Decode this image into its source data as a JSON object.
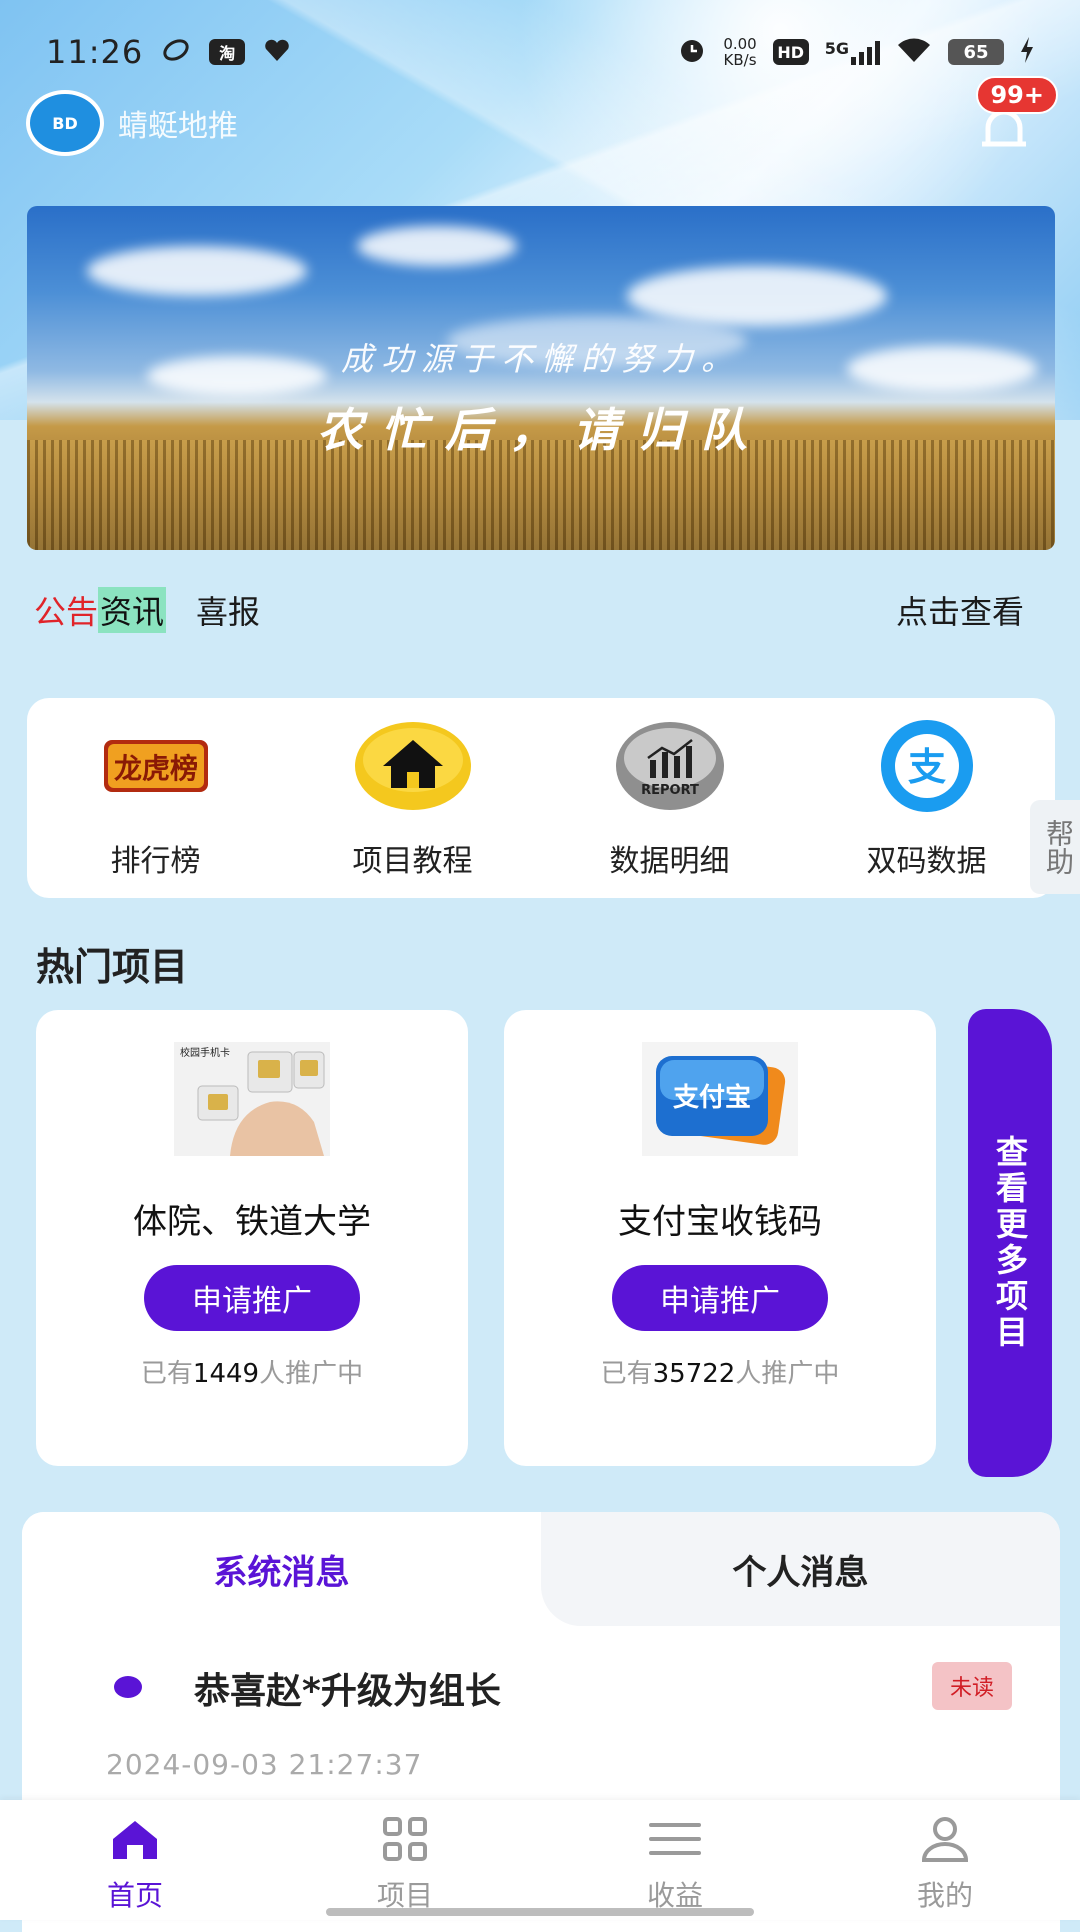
{
  "status_bar": {
    "time": "11:26",
    "left_icons": [
      "clouds-icon",
      "taobao-icon",
      "heart-icon"
    ],
    "taobao_label": "淘",
    "net_speed_value": "0.00",
    "net_speed_unit": "KB/s",
    "hd_label": "HD",
    "network": "5G",
    "battery": "65"
  },
  "app": {
    "name": "蜻蜓地推",
    "logo_text": "BD",
    "notification_badge": "99+"
  },
  "banner": {
    "line1": "成功源于不懈的努力。",
    "line2": "农忙后，请归队"
  },
  "notice": {
    "tag_red": "公告",
    "tag_green": "资讯",
    "title": "喜报",
    "more": "点击查看"
  },
  "quick_menu": [
    {
      "label": "排行榜",
      "icon": "ranking-badge-icon",
      "icon_text": "龙虎榜"
    },
    {
      "label": "项目教程",
      "icon": "home-icon"
    },
    {
      "label": "数据明细",
      "icon": "report-chart-icon",
      "icon_text": "REPORT"
    },
    {
      "label": "双码数据",
      "icon": "alipay-icon",
      "icon_text": "支"
    }
  ],
  "help_tab": "帮助",
  "hot_projects": {
    "title": "热门项目",
    "items": [
      {
        "name": "体院、铁道大学",
        "button": "申请推广",
        "count_prefix": "已有",
        "count": "1449",
        "count_suffix": "人推广中",
        "image_label": "校园手机卡"
      },
      {
        "name": "支付宝收钱码",
        "button": "申请推广",
        "count_prefix": "已有",
        "count": "35722",
        "count_suffix": "人推广中",
        "image_label": "支付宝"
      }
    ],
    "more": "查看更多项目"
  },
  "messages": {
    "tabs": [
      "系统消息",
      "个人消息"
    ],
    "active_tab": 0,
    "items": [
      {
        "title": "恭喜赵*升级为组长",
        "status": "未读",
        "time": "2024-09-03 21:27:37"
      }
    ]
  },
  "bottom_nav": [
    {
      "label": "首页",
      "icon": "home-icon",
      "active": true
    },
    {
      "label": "项目",
      "icon": "grid-icon",
      "active": false
    },
    {
      "label": "收益",
      "icon": "menu-lines-icon",
      "active": false
    },
    {
      "label": "我的",
      "icon": "user-icon",
      "active": false
    }
  ],
  "colors": {
    "accent": "#5a14d6",
    "unread_bg": "#f4c3c6",
    "unread_text": "#d11e26",
    "badge": "#e63632"
  }
}
